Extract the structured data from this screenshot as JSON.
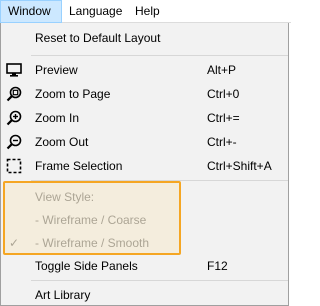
{
  "menubar": {
    "items": [
      {
        "label": "Window"
      },
      {
        "label": "Language"
      },
      {
        "label": "Help"
      }
    ]
  },
  "menu": {
    "reset": {
      "label": "Reset to Default Layout"
    },
    "preview": {
      "label": "Preview",
      "shortcut": "Alt+P",
      "icon": "monitor-icon"
    },
    "zoom_page": {
      "label": "Zoom to Page",
      "shortcut": "Ctrl+0",
      "icon": "zoom-page-icon"
    },
    "zoom_in": {
      "label": "Zoom In",
      "shortcut": "Ctrl+=",
      "icon": "zoom-in-icon"
    },
    "zoom_out": {
      "label": "Zoom Out",
      "shortcut": "Ctrl+-",
      "icon": "zoom-out-icon"
    },
    "frame": {
      "label": "Frame Selection",
      "shortcut": "Ctrl+Shift+A",
      "icon": "frame-selection-icon"
    },
    "view_style": {
      "label": "View Style:"
    },
    "wire_coarse": {
      "label": "-  Wireframe / Coarse"
    },
    "wire_smooth": {
      "label": "-  Wireframe / Smooth",
      "checked": true,
      "check": "✓"
    },
    "toggle_panels": {
      "label": "Toggle Side Panels",
      "shortcut": "F12"
    },
    "art_library": {
      "label": "Art Library"
    }
  },
  "colors": {
    "highlight_border": "#f5a623",
    "disabled_text": "#9a9a9a",
    "menu_background": "#f2f2f2",
    "open_menu_background": "#cce8ff"
  }
}
